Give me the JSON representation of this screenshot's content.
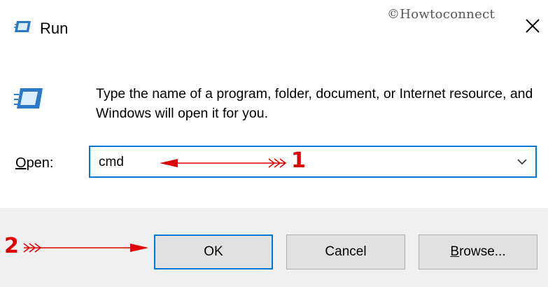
{
  "window": {
    "title": "Run",
    "watermark": "©Howtoconnect",
    "icon": "run-icon",
    "close_icon": "close-icon"
  },
  "body": {
    "message": "Type the name of a program, folder, document, or Internet resource, and Windows will open it for you.",
    "open_label_accel": "O",
    "open_label_rest": "pen:",
    "input_value": "cmd"
  },
  "buttons": {
    "ok": "OK",
    "cancel": "Cancel",
    "browse_accel": "B",
    "browse_rest": "rowse..."
  },
  "annotations": {
    "step1": "1",
    "step2": "2",
    "color": "#e10000"
  },
  "colors": {
    "accent": "#0078d7",
    "footer": "#f0f0f0",
    "button": "#e1e1e1"
  }
}
